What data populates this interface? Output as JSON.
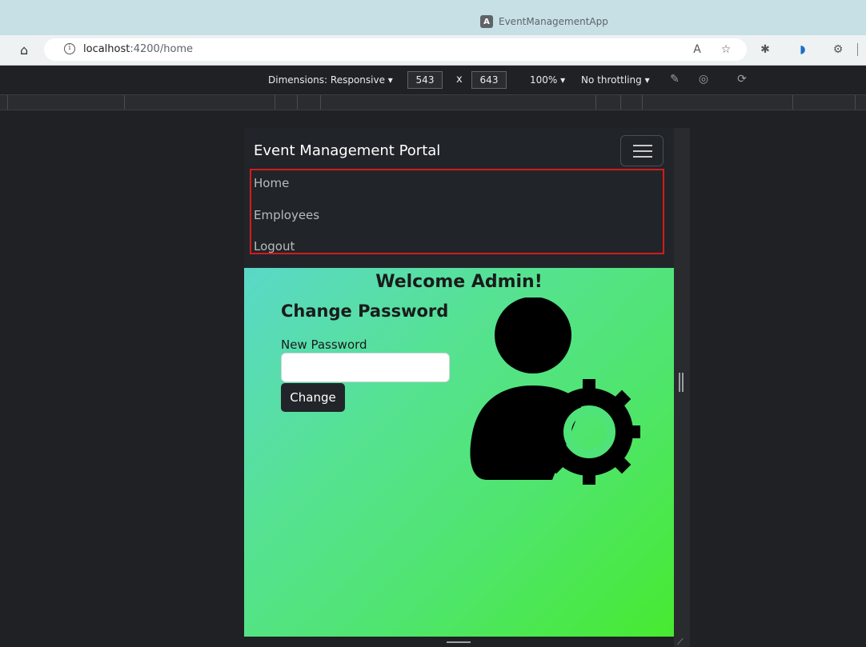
{
  "browser": {
    "window_title": "EventManagementApp",
    "url_host": "localhost",
    "url_rest": ":4200/home"
  },
  "devtools": {
    "dimensions_label": "Dimensions: Responsive",
    "width": "543",
    "height": "643",
    "times": "x",
    "zoom": "100%",
    "throttling": "No throttling"
  },
  "navbar": {
    "brand": "Event Management Portal",
    "links": [
      {
        "label": "Home"
      },
      {
        "label": "Employees"
      },
      {
        "label": "Logout"
      }
    ]
  },
  "main": {
    "welcome": "Welcome Admin!",
    "form_title": "Change Password",
    "password_label": "New Password",
    "password_value": "",
    "submit_label": "Change"
  },
  "colors": {
    "navbar_bg": "#212529",
    "highlight_border": "#d7191c",
    "gradient_start": "#5ad8c8",
    "gradient_end": "#47ea30"
  }
}
